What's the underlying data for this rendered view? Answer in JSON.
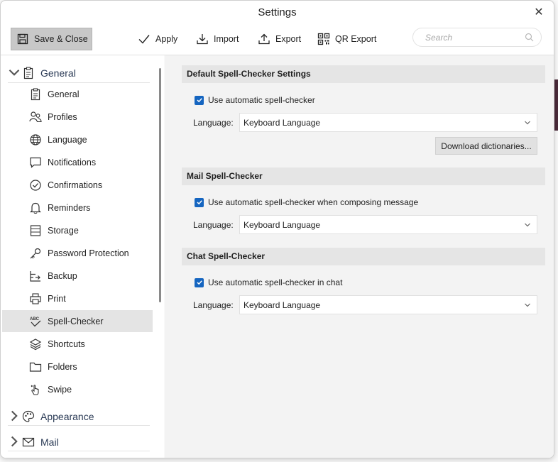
{
  "window": {
    "title": "Settings",
    "close_glyph": "✕"
  },
  "toolbar": {
    "save_close": "Save & Close",
    "apply": "Apply",
    "import": "Import",
    "export": "Export",
    "qr_export": "QR Export",
    "search_placeholder": "Search"
  },
  "sidebar": {
    "groups": [
      {
        "label": "General",
        "icon": "clipboard-icon",
        "expanded": true
      },
      {
        "label": "Appearance",
        "icon": "palette-icon",
        "expanded": false
      },
      {
        "label": "Mail",
        "icon": "envelope-icon",
        "expanded": false
      }
    ],
    "items": [
      {
        "label": "General",
        "icon": "clipboard-icon"
      },
      {
        "label": "Profiles",
        "icon": "people-icon"
      },
      {
        "label": "Language",
        "icon": "globe-icon"
      },
      {
        "label": "Notifications",
        "icon": "chat-bubble-icon"
      },
      {
        "label": "Confirmations",
        "icon": "check-circle-icon"
      },
      {
        "label": "Reminders",
        "icon": "bell-icon"
      },
      {
        "label": "Storage",
        "icon": "storage-icon"
      },
      {
        "label": "Password Protection",
        "icon": "key-icon"
      },
      {
        "label": "Backup",
        "icon": "backup-icon"
      },
      {
        "label": "Print",
        "icon": "printer-icon"
      },
      {
        "label": "Spell-Checker",
        "icon": "spellcheck-icon",
        "active": true
      },
      {
        "label": "Shortcuts",
        "icon": "layers-icon"
      },
      {
        "label": "Folders",
        "icon": "folder-icon"
      },
      {
        "label": "Swipe",
        "icon": "swipe-hand-icon"
      }
    ]
  },
  "main": {
    "sections": [
      {
        "title": "Default Spell-Checker Settings",
        "checkbox": "Use automatic spell-checker",
        "checked": true,
        "language_label": "Language:",
        "language_value": "Keyboard Language",
        "button": "Download dictionaries..."
      },
      {
        "title": "Mail Spell-Checker",
        "checkbox": "Use automatic spell-checker when composing message",
        "checked": true,
        "language_label": "Language:",
        "language_value": "Keyboard Language"
      },
      {
        "title": "Chat Spell-Checker",
        "checkbox": "Use automatic spell-checker in chat",
        "checked": true,
        "language_label": "Language:",
        "language_value": "Keyboard Language"
      }
    ]
  },
  "colors": {
    "accent": "#1565c0",
    "active_item": "#e4e4e4",
    "section_header": "#e5e5e5",
    "main_bg": "#f3f3f3"
  }
}
